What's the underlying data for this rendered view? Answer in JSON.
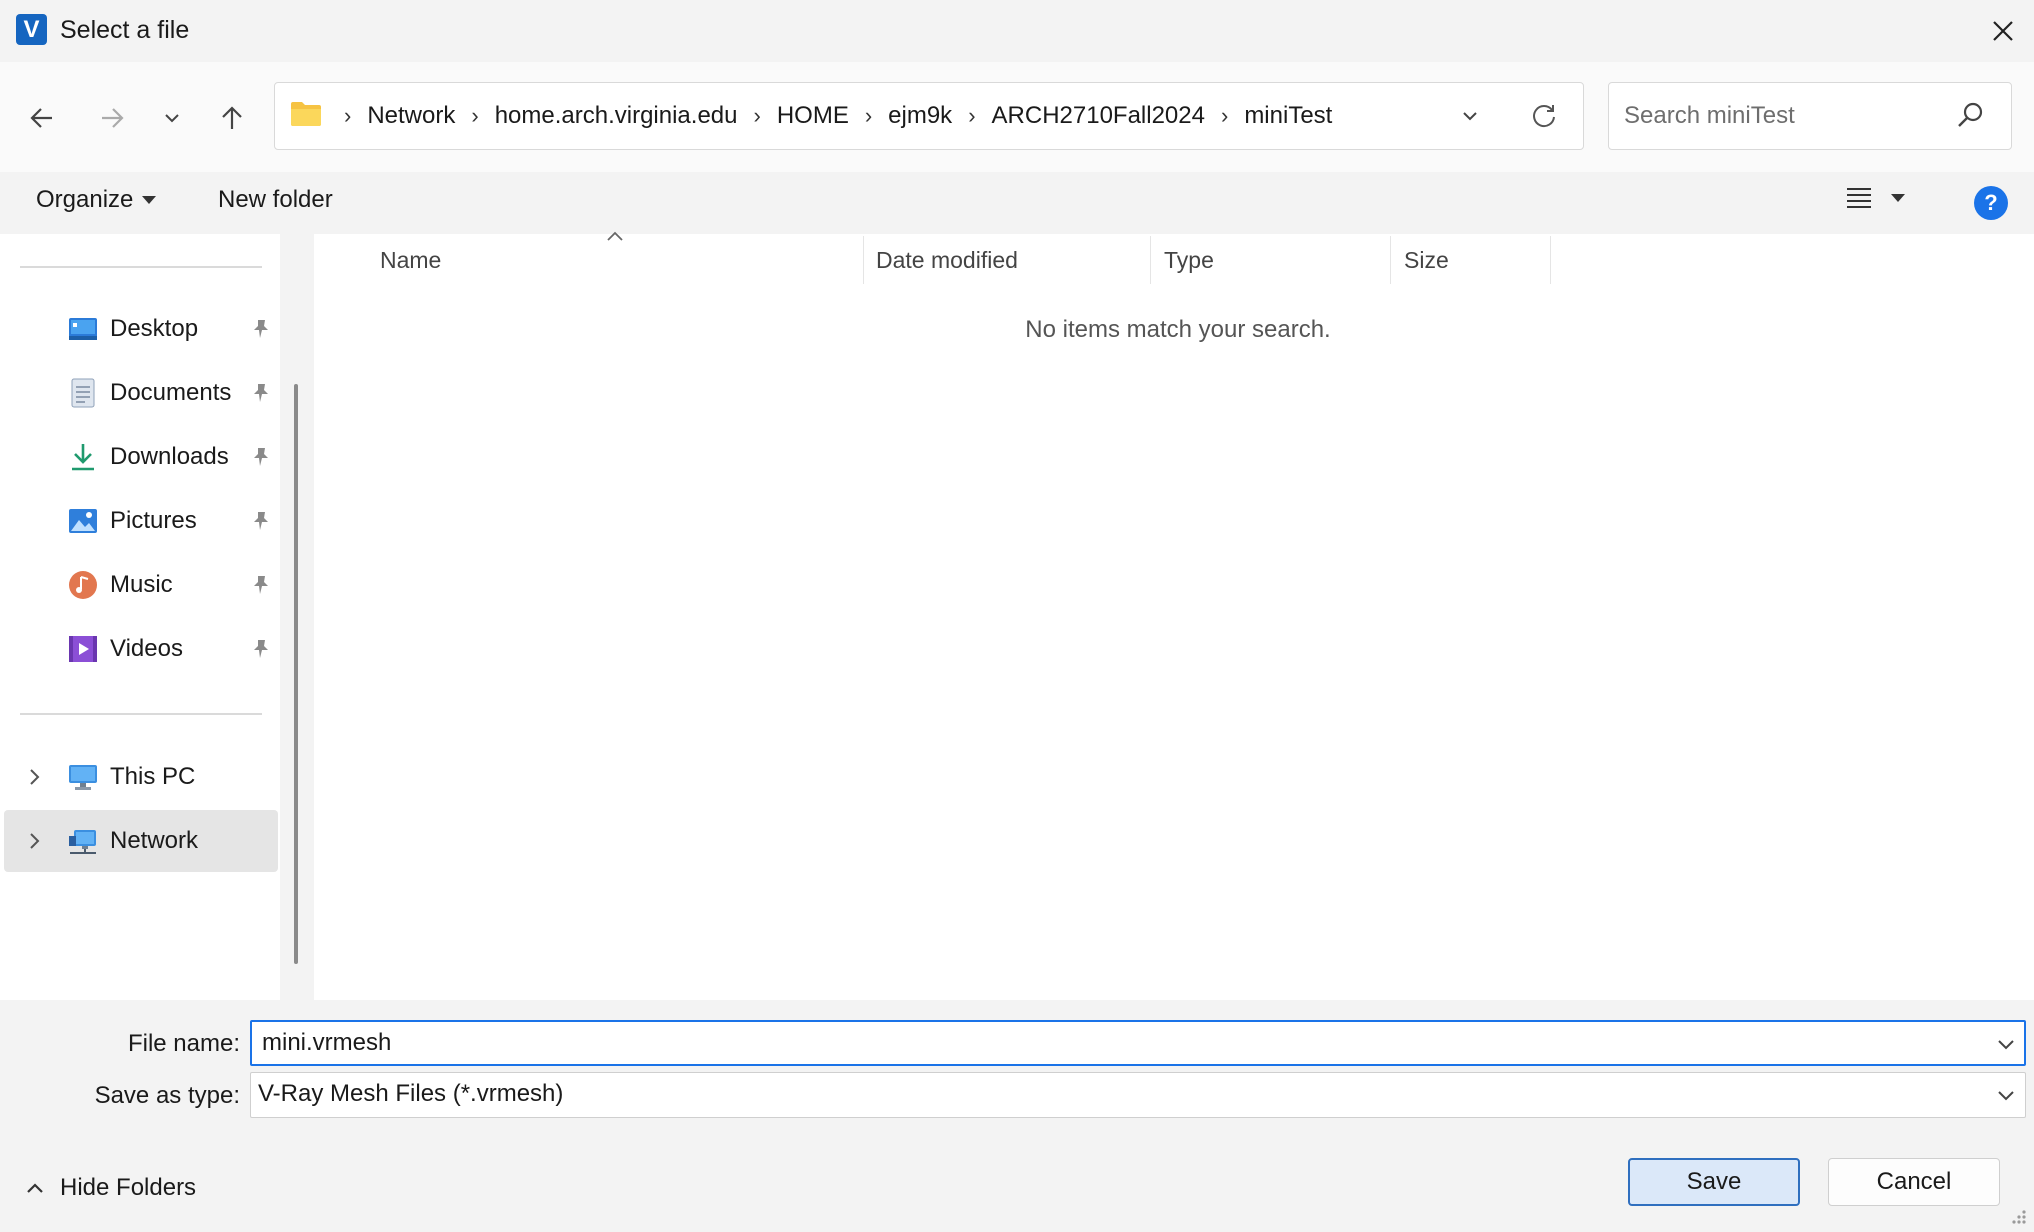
{
  "window": {
    "title": "Select a file"
  },
  "address": {
    "crumbs": [
      "Network",
      "home.arch.virginia.edu",
      "HOME",
      "ejm9k",
      "ARCH2710Fall2024",
      "miniTest"
    ]
  },
  "search": {
    "placeholder": "Search miniTest"
  },
  "toolbar": {
    "organize_label": "Organize",
    "new_folder_label": "New folder",
    "help_label": "?"
  },
  "sidebar": {
    "quick_access": [
      {
        "label": "Desktop",
        "icon": "desktop-icon"
      },
      {
        "label": "Documents",
        "icon": "documents-icon"
      },
      {
        "label": "Downloads",
        "icon": "downloads-icon"
      },
      {
        "label": "Pictures",
        "icon": "pictures-icon"
      },
      {
        "label": "Music",
        "icon": "music-icon"
      },
      {
        "label": "Videos",
        "icon": "videos-icon"
      }
    ],
    "locations": [
      {
        "label": "This PC",
        "icon": "computer-icon"
      },
      {
        "label": "Network",
        "icon": "network-icon",
        "selected": true
      }
    ]
  },
  "filelist": {
    "columns": [
      "Name",
      "Date modified",
      "Type",
      "Size"
    ],
    "empty_message": "No items match your search."
  },
  "form": {
    "file_name_label": "File name:",
    "file_name_value": "mini.vrmesh",
    "save_type_label": "Save as type:",
    "save_type_value": "V-Ray Mesh Files (*.vrmesh)"
  },
  "footer": {
    "hide_folders_label": "Hide Folders",
    "save_label": "Save",
    "cancel_label": "Cancel"
  },
  "colors": {
    "accent": "#1a73e8",
    "selected_bg": "#e5e5e5",
    "save_bg": "#dbe8f9"
  }
}
